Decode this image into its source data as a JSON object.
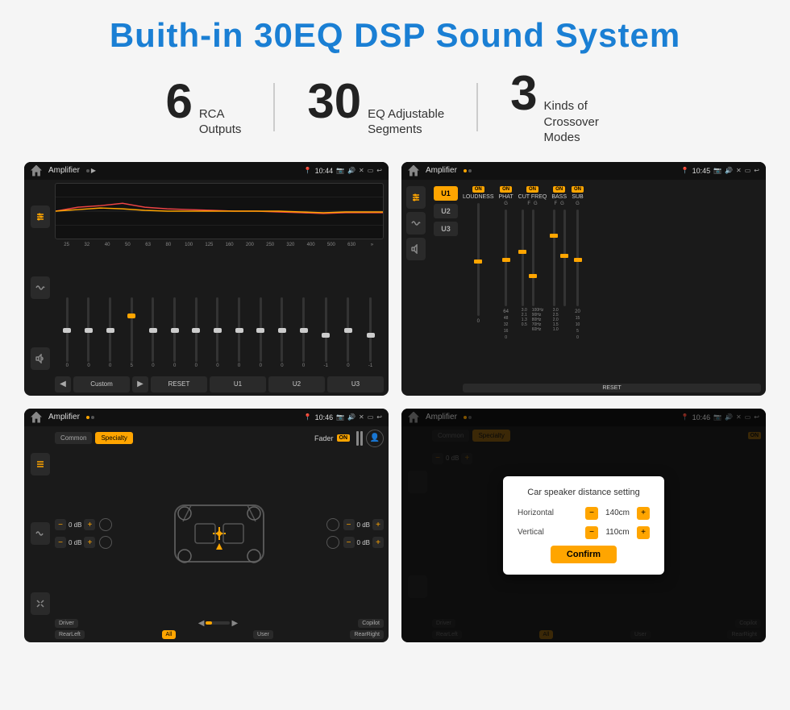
{
  "title": "Buith-in 30EQ DSP Sound System",
  "stats": [
    {
      "number": "6",
      "label": "RCA\nOutputs"
    },
    {
      "number": "30",
      "label": "EQ Adjustable\nSegments"
    },
    {
      "number": "3",
      "label": "Kinds of\nCrossover Modes"
    }
  ],
  "screenshots": [
    {
      "id": "eq-screen",
      "time": "10:44",
      "app": "Amplifier"
    },
    {
      "id": "crossover-screen",
      "time": "10:45",
      "app": "Amplifier"
    },
    {
      "id": "fader-screen",
      "time": "10:46",
      "app": "Amplifier"
    },
    {
      "id": "dialog-screen",
      "time": "10:46",
      "app": "Amplifier",
      "dialog": {
        "title": "Car speaker distance setting",
        "horizontal_label": "Horizontal",
        "horizontal_value": "140cm",
        "vertical_label": "Vertical",
        "vertical_value": "110cm",
        "confirm_label": "Confirm"
      }
    }
  ],
  "eq": {
    "frequencies": [
      "25",
      "32",
      "40",
      "50",
      "63",
      "80",
      "100",
      "125",
      "160",
      "200",
      "250",
      "320",
      "400",
      "500",
      "630"
    ],
    "values": [
      "0",
      "0",
      "0",
      "5",
      "0",
      "0",
      "0",
      "0",
      "0",
      "0",
      "0",
      "0",
      "-1",
      "0",
      "-1"
    ],
    "preset": "Custom",
    "buttons": [
      "RESET",
      "U1",
      "U2",
      "U3"
    ]
  },
  "crossover": {
    "u_buttons": [
      "U1",
      "U2",
      "U3"
    ],
    "active_u": "U1",
    "channels": [
      "LOUDNESS",
      "PHAT",
      "CUT FREQ",
      "BASS",
      "SUB"
    ],
    "all_on": true
  },
  "fader": {
    "modes": [
      "Common",
      "Specialty"
    ],
    "active_mode": "Specialty",
    "fader_label": "Fader",
    "on_label": "ON",
    "vol_labels": [
      "0 dB",
      "0 dB",
      "0 dB",
      "0 dB"
    ],
    "bottom_buttons": [
      "Driver",
      "",
      "Copilot",
      "RearLeft",
      "All",
      "",
      "User",
      "RearRight"
    ]
  },
  "dialog": {
    "title": "Car speaker distance setting",
    "horizontal_label": "Horizontal",
    "horizontal_value": "140cm",
    "vertical_label": "Vertical",
    "vertical_value": "110cm",
    "confirm_label": "Confirm"
  }
}
